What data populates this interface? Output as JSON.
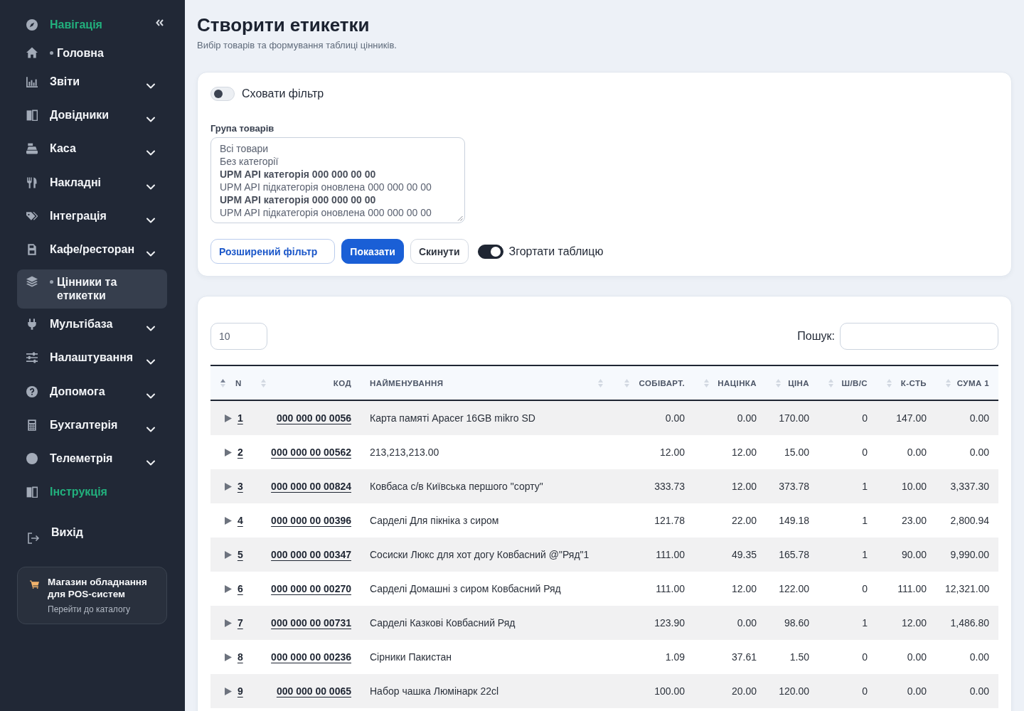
{
  "sidebar": {
    "title": "Навігація",
    "items": [
      {
        "label": "Головна",
        "kind": "link",
        "selected": false
      },
      {
        "label": "Звіти",
        "kind": "group",
        "selected": false
      },
      {
        "label": "Довідники",
        "kind": "group",
        "selected": false
      },
      {
        "label": "Каса",
        "kind": "group",
        "selected": false
      },
      {
        "label": "Накладні",
        "kind": "group",
        "selected": false
      },
      {
        "label": "Інтеграція",
        "kind": "group",
        "selected": false
      },
      {
        "label": "Кафе/ресторан",
        "kind": "group",
        "selected": false
      },
      {
        "label": "Цінники та етикетки",
        "kind": "link",
        "selected": true
      },
      {
        "label": "Мультібаза",
        "kind": "group",
        "selected": false
      },
      {
        "label": "Налаштування",
        "kind": "group",
        "selected": false
      },
      {
        "label": "Допомога",
        "kind": "group",
        "selected": false
      },
      {
        "label": "Бухгалтерія",
        "kind": "group",
        "selected": false
      },
      {
        "label": "Телеметрія",
        "kind": "group",
        "selected": false
      },
      {
        "label": "Інструкція",
        "kind": "accent",
        "selected": false
      },
      {
        "label": "Вихід",
        "kind": "logout",
        "selected": false
      }
    ],
    "promo": {
      "title": "Магазин обладнання для POS-систем",
      "link": "Перейти до каталогу"
    }
  },
  "header": {
    "title": "Створити етикетки",
    "subtitle": "Вибір товарів та формування таблиці цінників."
  },
  "filter_panel": {
    "hide_filter": {
      "label": "Сховати фільтр",
      "on": false
    },
    "group_field": {
      "label": "Група товарів",
      "options": [
        {
          "label": "Всі товари",
          "kind": "item",
          "selected": false
        },
        {
          "label": "Без категорії",
          "kind": "item",
          "selected": false
        },
        {
          "label": "UPM API категорія 000 000 00 00",
          "kind": "category",
          "selected": false
        },
        {
          "label": "UPM API підкатегорія оновлена 000 000 00 00",
          "kind": "item",
          "selected": false
        },
        {
          "label": "UPM API категорія 000 000 00 00",
          "kind": "category",
          "selected": false
        },
        {
          "label": "UPM API підкатегорія оновлена 000 000 00 00",
          "kind": "item",
          "selected": false
        }
      ]
    },
    "buttons": [
      {
        "label": "Розширений фільтр",
        "kind": "outline"
      },
      {
        "label": "Показати",
        "kind": "primary"
      },
      {
        "label": "Скинути",
        "kind": "secondary"
      }
    ],
    "collapse_table": {
      "label": "Згортати таблицю",
      "on": true
    }
  },
  "table_panel": {
    "page_length": {
      "value": "10"
    },
    "search": {
      "label": "Пошук:"
    },
    "table": {
      "columns": [
        {
          "label": "N",
          "sorted": true
        },
        {
          "label": "КОД",
          "sorted": false
        },
        {
          "label": "НАЙМЕНУВАННЯ",
          "sorted": false
        },
        {
          "label": "СОБІВАРТ.",
          "sorted": false
        },
        {
          "label": "НАЦІНКА",
          "sorted": false
        },
        {
          "label": "ЦІНА",
          "sorted": false
        },
        {
          "label": "Ш/В/С",
          "sorted": false
        },
        {
          "label": "К-СТЬ",
          "sorted": false
        },
        {
          "label": "СУМА 1",
          "sorted": false
        }
      ],
      "rows": [
        {
          "n": "1",
          "code": "000 000 00 0056",
          "name": "Карта памяті Apacer 16GB mikro SD",
          "cost": "0.00",
          "markup": "0.00",
          "price": "170.00",
          "wsc": "0",
          "qty": "147.00",
          "sum_1": "0.00"
        },
        {
          "n": "2",
          "code": "000 000 00 00562",
          "name": "213,213,213.00",
          "cost": "12.00",
          "markup": "12.00",
          "price": "15.00",
          "wsc": "0",
          "qty": "0.00",
          "sum_1": "0.00"
        },
        {
          "n": "3",
          "code": "000 000 00 00824",
          "name": "Ковбаса с/в Київська першого \"сорту\"",
          "cost": "333.73",
          "markup": "12.00",
          "price": "373.78",
          "wsc": "1",
          "qty": "10.00",
          "sum_1": "3,337.30"
        },
        {
          "n": "4",
          "code": "000 000 00 00396",
          "name": "Сарделі Для пікніка з сиром",
          "cost": "121.78",
          "markup": "22.00",
          "price": "149.18",
          "wsc": "1",
          "qty": "23.00",
          "sum_1": "2,800.94"
        },
        {
          "n": "5",
          "code": "000 000 00 00347",
          "name": "Сосиски Люкс для хот догу Ковбасний @\"Ряд\"1",
          "cost": "111.00",
          "markup": "49.35",
          "price": "165.78",
          "wsc": "1",
          "qty": "90.00",
          "sum_1": "9,990.00"
        },
        {
          "n": "6",
          "code": "000 000 00 00270",
          "name": "Сарделі Домашні з сиром Ковбасний Ряд",
          "cost": "111.00",
          "markup": "12.00",
          "price": "122.00",
          "wsc": "0",
          "qty": "111.00",
          "sum_1": "12,321.00"
        },
        {
          "n": "7",
          "code": "000 000 00 00731",
          "name": "Сарделі Казкові Ковбасний Ряд",
          "cost": "123.90",
          "markup": "0.00",
          "price": "98.60",
          "wsc": "1",
          "qty": "12.00",
          "sum_1": "1,486.80"
        },
        {
          "n": "8",
          "code": "000 000 00 00236",
          "name": "Сірники Пакистан",
          "cost": "1.09",
          "markup": "37.61",
          "price": "1.50",
          "wsc": "0",
          "qty": "0.00",
          "sum_1": "0.00"
        },
        {
          "n": "9",
          "code": "000 000 00 0065",
          "name": "Набор чашка Люмінарк 22cl",
          "cost": "100.00",
          "markup": "20.00",
          "price": "120.00",
          "wsc": "0",
          "qty": "0.00",
          "sum_1": "0.00"
        }
      ]
    }
  }
}
